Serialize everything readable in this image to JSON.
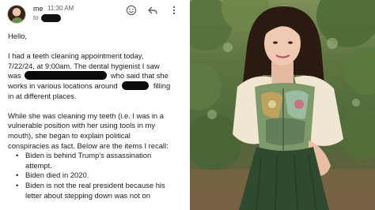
{
  "email": {
    "sender": "me",
    "time": "11:30 AM",
    "to_label": "to",
    "icons": {
      "emoji": "smile-icon",
      "reply": "reply-icon",
      "more": "more-vertical-icon"
    },
    "greeting": "Hello,",
    "p1_a": "I had a teeth cleaning appointment today,",
    "p1_b": "7/22/24, at 9:00am. The dental hygienist I saw",
    "p1_c1": "was",
    "p1_c2": "who said that she",
    "p1_d1": "works in various locations around",
    "p1_d2": "filling",
    "p1_e": "in at different places.",
    "p2_a": "While she was cleaning my teeth (i.e. I was in a",
    "p2_b": "vulnerable position with her using tools in my",
    "p2_c": "mouth), she began to explain political",
    "p2_d": "conspiracies as fact. Below are the items I recall:",
    "items": [
      {
        "l1": "Biden is behind Trump's assassination",
        "l2": "attempt."
      },
      {
        "l1": "Biden died in 2020.",
        "l2": ""
      },
      {
        "l1": "Biden is not the real president because his",
        "l2": "letter about stepping down was not on"
      }
    ]
  },
  "colors": {
    "text": "#202124",
    "muted": "#5f6368",
    "redaction": "#0b0b0b"
  }
}
